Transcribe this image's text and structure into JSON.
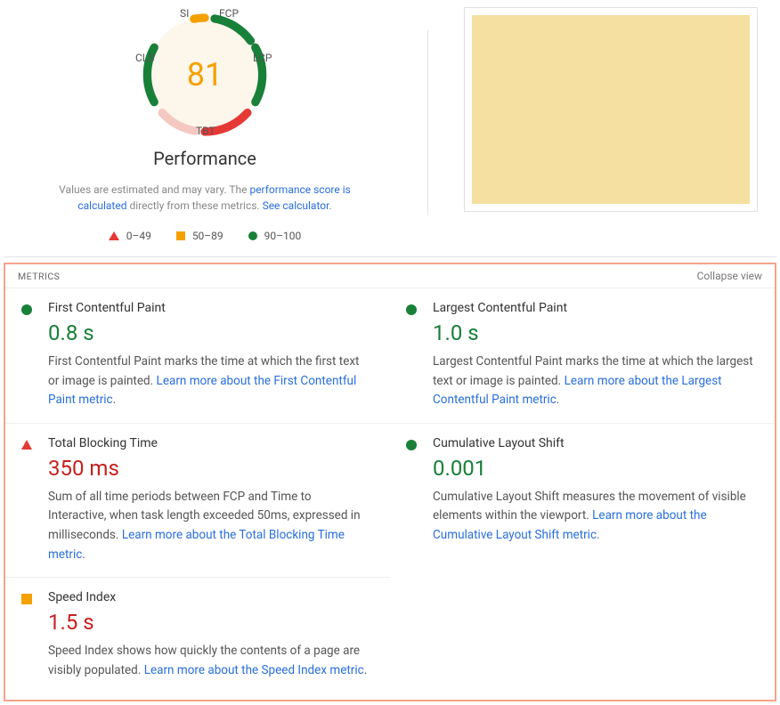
{
  "gauge": {
    "score": "81",
    "title": "Performance",
    "segments": {
      "si": "SI",
      "fcp": "FCP",
      "cls": "CLS",
      "lcp": "LCP",
      "tbt": "TBT"
    }
  },
  "disclaimer": {
    "prefix": "Values are estimated and may vary. The ",
    "link1": "performance score is calculated",
    "middle": " directly from these metrics. ",
    "link2": "See calculator"
  },
  "legend": {
    "low": "0–49",
    "mid": "50–89",
    "high": "90–100"
  },
  "metrics_header": {
    "title": "METRICS",
    "collapse": "Collapse view"
  },
  "metrics_left": [
    {
      "status": "pass",
      "name": "First Contentful Paint",
      "value": "0.8 s",
      "desc": "First Contentful Paint marks the time at which the first text or image is painted. ",
      "link": "Learn more about the First Contentful Paint metric"
    },
    {
      "status": "fail",
      "name": "Total Blocking Time",
      "value": "350 ms",
      "desc": "Sum of all time periods between FCP and Time to Interactive, when task length exceeded 50ms, expressed in milliseconds. ",
      "link": "Learn more about the Total Blocking Time metric"
    },
    {
      "status": "avg",
      "name": "Speed Index",
      "value": "1.5 s",
      "desc": "Speed Index shows how quickly the contents of a page are visibly populated. ",
      "link": "Learn more about the Speed Index metric"
    }
  ],
  "metrics_right": [
    {
      "status": "pass",
      "name": "Largest Contentful Paint",
      "value": "1.0 s",
      "desc": "Largest Contentful Paint marks the time at which the largest text or image is painted. ",
      "link": "Learn more about the Largest Contentful Paint metric"
    },
    {
      "status": "pass",
      "name": "Cumulative Layout Shift",
      "value": "0.001",
      "desc": "Cumulative Layout Shift measures the movement of visible elements within the viewport. ",
      "link": "Learn more about the Cumulative Layout Shift metric"
    }
  ]
}
